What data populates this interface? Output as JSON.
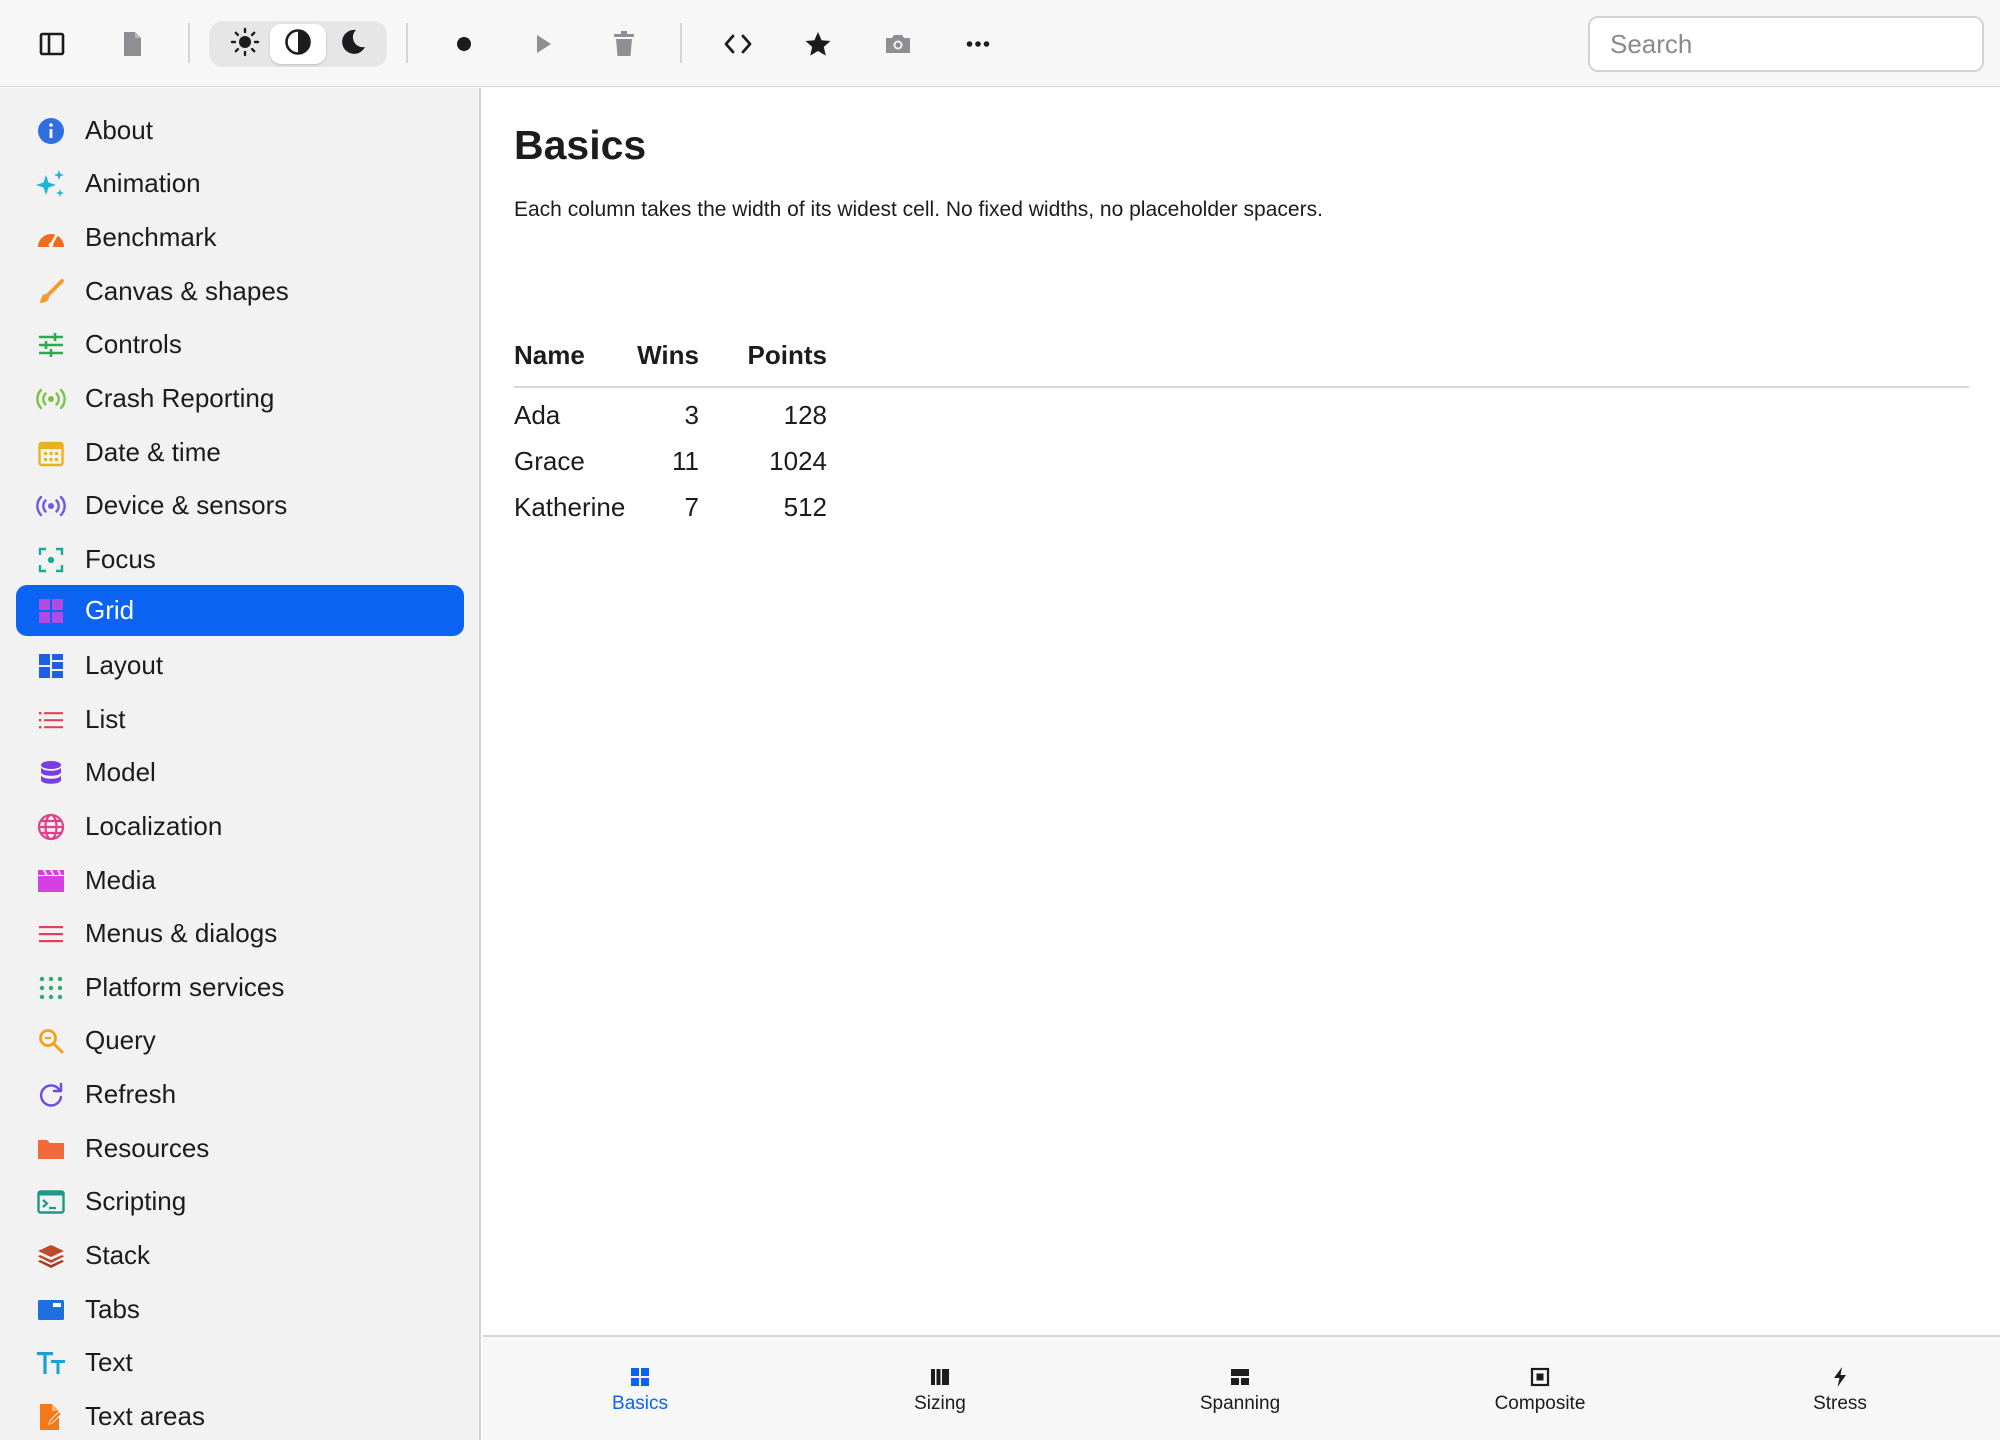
{
  "toolbar": {
    "buttons": [
      {
        "icon": "sidebar-toggle-icon"
      },
      {
        "icon": "document-icon"
      },
      {
        "icon": "record-icon"
      },
      {
        "icon": "play-icon"
      },
      {
        "icon": "trash-icon"
      },
      {
        "icon": "code-icon"
      },
      {
        "icon": "star-icon"
      },
      {
        "icon": "camera-icon"
      },
      {
        "icon": "more-icon"
      }
    ],
    "appearance": {
      "options": [
        "light",
        "auto",
        "dark"
      ],
      "selected": "auto"
    },
    "search": {
      "placeholder": "Search",
      "value": ""
    }
  },
  "sidebar": {
    "selected": "Grid",
    "items": [
      {
        "label": "About",
        "icon": "info-icon",
        "color": "#2f6fe0"
      },
      {
        "label": "Animation",
        "icon": "sparkles-icon",
        "color": "#1cb5d8"
      },
      {
        "label": "Benchmark",
        "icon": "gauge-icon",
        "color": "#f26a1b"
      },
      {
        "label": "Canvas & shapes",
        "icon": "paintbrush-icon",
        "color": "#f59a2e"
      },
      {
        "label": "Controls",
        "icon": "sliders-icon",
        "color": "#2fa84f"
      },
      {
        "label": "Crash Reporting",
        "icon": "broadcast-icon",
        "color": "#7cc242"
      },
      {
        "label": "Date & time",
        "icon": "calendar-icon",
        "color": "#e8b21f"
      },
      {
        "label": "Device & sensors",
        "icon": "sensor-icon",
        "color": "#6a5ae0"
      },
      {
        "label": "Focus",
        "icon": "focus-icon",
        "color": "#1aa99a"
      },
      {
        "label": "Grid",
        "icon": "grid-icon",
        "color": "#b44be1"
      },
      {
        "label": "Layout",
        "icon": "layout-icon",
        "color": "#1f5fe0"
      },
      {
        "label": "List",
        "icon": "list-icon",
        "color": "#e0404a"
      },
      {
        "label": "Model",
        "icon": "database-icon",
        "color": "#7a3de0"
      },
      {
        "label": "Localization",
        "icon": "globe-icon",
        "color": "#e0408a"
      },
      {
        "label": "Media",
        "icon": "film-icon",
        "color": "#d63fe0"
      },
      {
        "label": "Menus & dialogs",
        "icon": "menu-icon",
        "color": "#e0405a"
      },
      {
        "label": "Platform services",
        "icon": "dots-grid-icon",
        "color": "#2fa87a"
      },
      {
        "label": "Query",
        "icon": "magnifier-icon",
        "color": "#f0a21b"
      },
      {
        "label": "Refresh",
        "icon": "refresh-icon",
        "color": "#6a4ae0"
      },
      {
        "label": "Resources",
        "icon": "folder-icon",
        "color": "#f26a3a"
      },
      {
        "label": "Scripting",
        "icon": "terminal-icon",
        "color": "#1a9a8a"
      },
      {
        "label": "Stack",
        "icon": "layers-icon",
        "color": "#c0482a"
      },
      {
        "label": "Tabs",
        "icon": "tabs-icon",
        "color": "#1f6fe0"
      },
      {
        "label": "Text",
        "icon": "text-size-icon",
        "color": "#1aa0d8"
      },
      {
        "label": "Text areas",
        "icon": "doc-edit-icon",
        "color": "#f27a1a"
      }
    ]
  },
  "main": {
    "title": "Basics",
    "description": "Each column takes the width of its widest cell. No fixed widths, no placeholder spacers.",
    "table": {
      "columns": [
        "Name",
        "Wins",
        "Points"
      ],
      "rows": [
        [
          "Ada",
          "3",
          "128"
        ],
        [
          "Grace",
          "11",
          "1024"
        ],
        [
          "Katherine",
          "7",
          "512"
        ]
      ]
    }
  },
  "tabbar": {
    "selected": "Basics",
    "tabs": [
      {
        "label": "Basics",
        "icon": "grid-icon"
      },
      {
        "label": "Sizing",
        "icon": "columns-icon"
      },
      {
        "label": "Spanning",
        "icon": "spanning-icon"
      },
      {
        "label": "Composite",
        "icon": "composite-icon"
      },
      {
        "label": "Stress",
        "icon": "bolt-icon"
      }
    ]
  },
  "colors": {
    "accent": "#0a63f3",
    "sidebar_bg": "#f2f2f2",
    "toolbar_bg": "#f7f7f7"
  }
}
